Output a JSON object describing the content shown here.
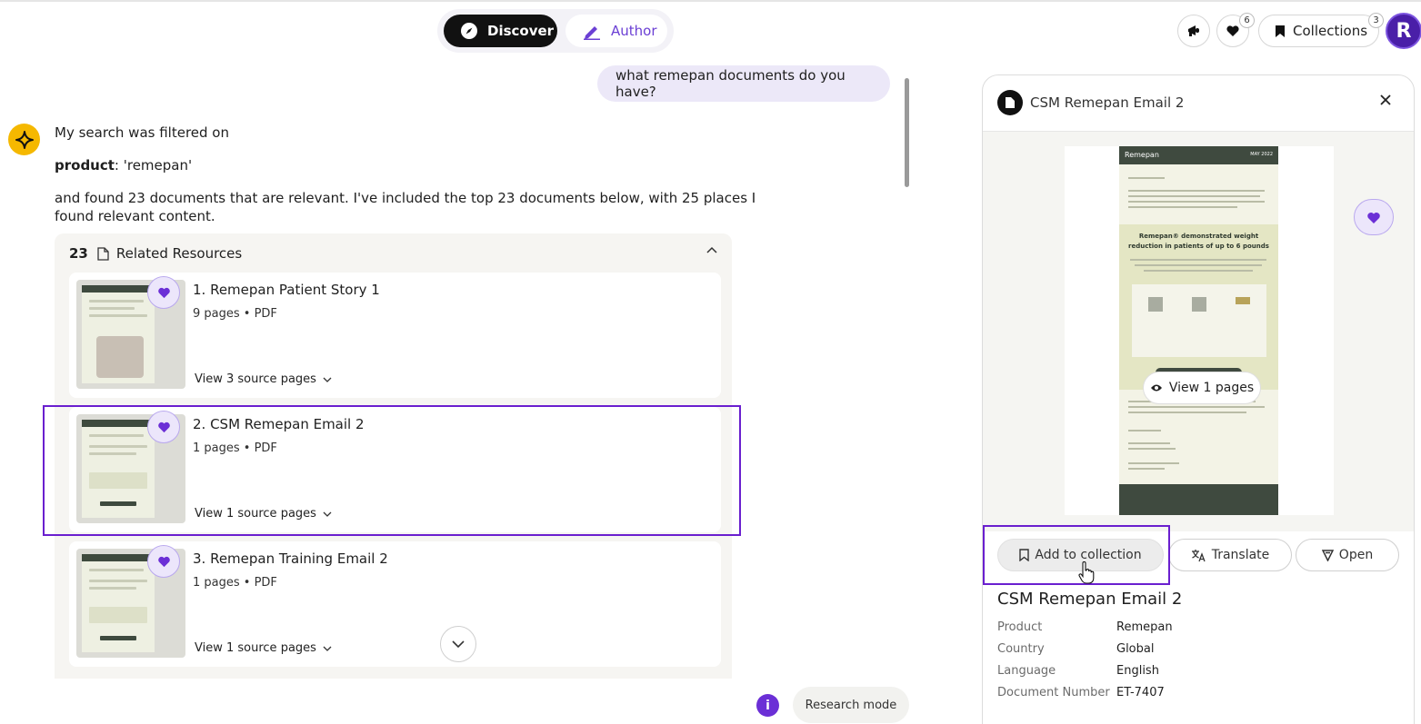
{
  "modes": {
    "discover_label": "Discover",
    "author_label": "Author"
  },
  "header": {
    "likes_count": "6",
    "collections_label": "Collections",
    "collections_count": "3",
    "avatar_initial": "R"
  },
  "chat": {
    "user_query": "what remepan documents do you have?",
    "bot_line1": "My search was filtered on",
    "filter_key": "product",
    "filter_value": ": 'remepan'",
    "bot_line3a": "and found 23 documents that are relevant. I've included the top 23 documents below, with 25 places I",
    "bot_line3b": "found relevant content."
  },
  "related": {
    "count": "23",
    "title": "Related Resources",
    "items": [
      {
        "title": "1. Remepan Patient Story 1",
        "meta": "9 pages • PDF",
        "source": "View 3 source pages"
      },
      {
        "title": "2. CSM Remepan Email 2",
        "meta": "1 pages • PDF",
        "source": "View 1 source pages"
      },
      {
        "title": "3. Remepan Training Email 2",
        "meta": "1 pages • PDF",
        "source": "View 1 source pages"
      }
    ]
  },
  "footer": {
    "info_glyph": "i",
    "research_label": "Research mode"
  },
  "side": {
    "title": "CSM Remepan Email 2",
    "view_pages_label": "View 1 pages",
    "preview": {
      "brand": "Remepan",
      "date": "MAY 2022",
      "headline": "Remepan® demonstrated weight reduction in patients of up to 6 pounds"
    },
    "actions": {
      "add_label": "Add to collection",
      "translate_label": "Translate",
      "open_label": "Open"
    },
    "detail_title": "CSM Remepan Email 2",
    "details": [
      {
        "label": "Product",
        "value": "Remepan"
      },
      {
        "label": "Country",
        "value": "Global"
      },
      {
        "label": "Language",
        "value": "English"
      },
      {
        "label": "Document Number",
        "value": "ET-7407"
      }
    ]
  },
  "colors": {
    "accent": "#6b3fd4",
    "highlight": "#6a1fcf",
    "bot_avatar": "#f5b800"
  }
}
